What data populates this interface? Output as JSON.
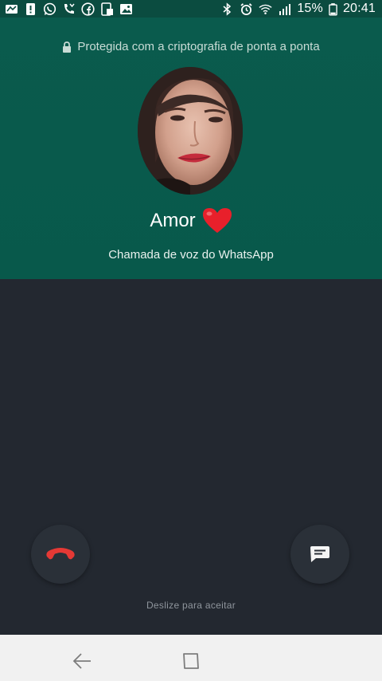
{
  "status_bar": {
    "battery_percent": "15%",
    "time": "20:41",
    "icons_left": [
      "sim-icon",
      "alert-icon",
      "whatsapp-icon",
      "missed-call-icon",
      "facebook-icon",
      "screenshot-icon",
      "gallery-icon"
    ],
    "icons_right": [
      "bluetooth-icon",
      "alarm-icon",
      "wifi-icon",
      "signal-icon",
      "battery-icon"
    ]
  },
  "header": {
    "encryption_text": "Protegida com a criptografia de ponta a ponta",
    "contact_name": "Amor",
    "call_type": "Chamada de voz do WhatsApp"
  },
  "actions": {
    "swipe_hint": "Deslize para aceitar",
    "decline_icon": "phone-hangup-icon",
    "message_icon": "message-icon"
  },
  "colors": {
    "header_bg": "#0a5b4d",
    "body_bg": "#232830",
    "decline": "#e53935",
    "nav_bg": "#f1f1f1"
  }
}
